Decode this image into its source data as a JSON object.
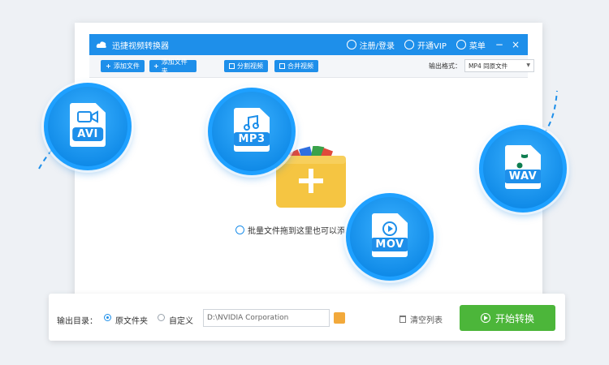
{
  "window": {
    "title": "迅捷视频转换器",
    "register": "注册/登录",
    "vip": "开通VIP",
    "menu": "菜单",
    "minimize": "−",
    "close": "×"
  },
  "toolbar": {
    "add_file": "添加文件",
    "add_folder": "添加文件夹",
    "split_video": "分割视频",
    "merge_video": "合并视频",
    "output_format_label": "输出格式：",
    "output_format_value": "MP4  同原文件"
  },
  "formats": {
    "avi": "AVI",
    "mp3": "MP3",
    "mov": "MOV",
    "wav": "WAV"
  },
  "drop_hint": "批量文件拖到这里也可以添",
  "bottom": {
    "output_dir_label": "输出目录：",
    "original_folder": "原文件夹",
    "custom": "自定义",
    "path_value": "D:\\NVIDIA Corporation",
    "clear_list": "清空列表",
    "start": "开始转换"
  },
  "colors": {
    "brand_blue": "#1e8fea",
    "start_green": "#4cb63a",
    "folder_yellow": "#f5c542"
  },
  "icons": {
    "logo": "cloud-logo-icon",
    "user": "user-icon",
    "vip": "vip-cart-icon",
    "menu": "menu-icon",
    "add": "plus-icon",
    "split": "split-icon",
    "merge": "merge-icon",
    "video": "video-camera-icon",
    "music": "music-note-icon",
    "play": "play-icon",
    "folder": "folder-icon",
    "trash": "trash-icon"
  }
}
